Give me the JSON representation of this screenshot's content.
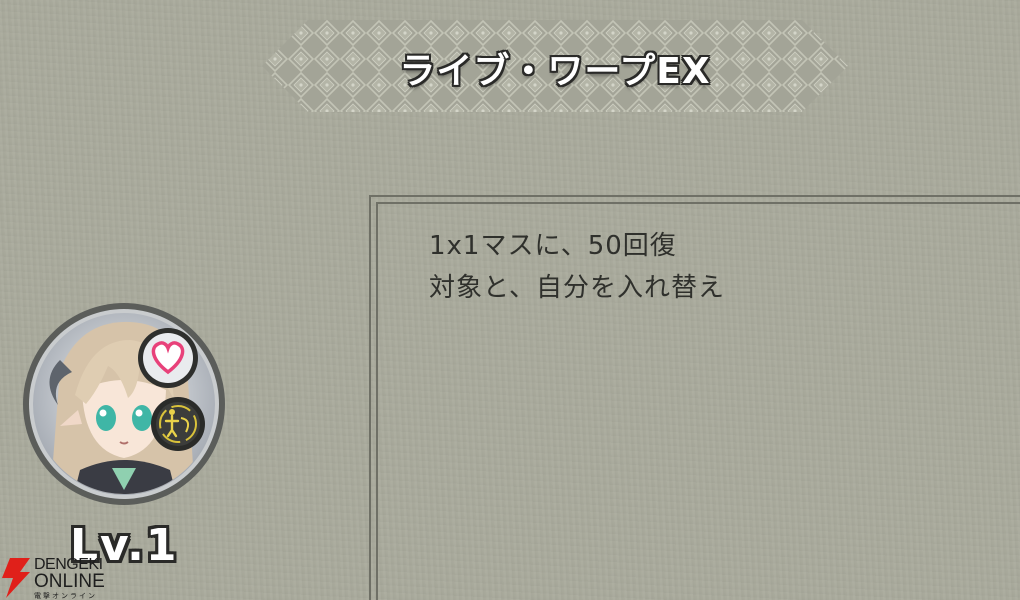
{
  "skill": {
    "title": "ライブ・ワープEX",
    "description": [
      "1x1マスに、50回復",
      "対象と、自分を入れ替え"
    ]
  },
  "character": {
    "level": "Lv.1",
    "badges": [
      "heart-icon",
      "fairy-attribute-icon"
    ]
  },
  "watermark": {
    "line1": "DENGEKI",
    "line2": "ONLINE",
    "line3": "電撃オンライン"
  },
  "colors": {
    "background": "#a9aa9c",
    "panel_border": "#6f7066",
    "text": "#2f302c",
    "heart": "#e8417a",
    "attribute": "#d9c23a",
    "logo_red": "#e0201a"
  }
}
